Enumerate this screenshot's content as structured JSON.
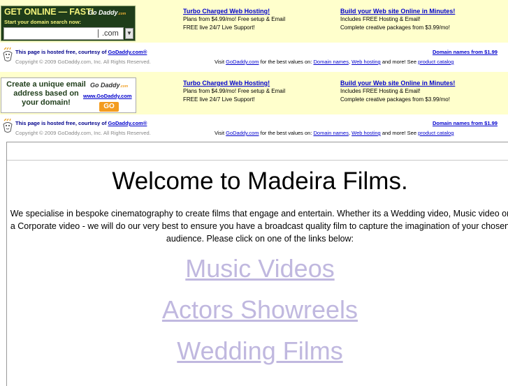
{
  "colors": {
    "ad_bg": "#ffffcc",
    "link_blue": "#0000cc",
    "nav_link": "#c0b8df",
    "banner_green": "#1f3d1a",
    "banner_yellow": "#f2f27a",
    "go_orange": "#f39c20"
  },
  "ad_top": {
    "banner": {
      "headline": "GET ONLINE — FAST!",
      "subline": "Start your domain search now:",
      "logo": "Go Daddy",
      "logo_suffix": ".com",
      "field_suffix": ".com",
      "dropdown_icon": "chevron-down-icon"
    },
    "col1": {
      "heading": "Turbo Charged Web Hosting!",
      "line1": "Plans from $4.99/mo! Free setup & Email",
      "line2": "FREE live 24/7 Live Support!"
    },
    "col2": {
      "heading": "Build your Web site Online in Minutes!",
      "line1": "Includes FREE Hosting & Email!",
      "line2": "Complete creative packages from $3.99/mo!"
    }
  },
  "credit_top": {
    "lead": "This page is hosted free, courtesy of",
    "link": "GoDaddy.com®",
    "copyright": "Copyright © 2009 GoDaddy.com, Inc. All Rights Reserved.",
    "right_link": "Domain names from $1.99",
    "visit_prefix": "Visit",
    "visit_link": "GoDaddy.com",
    "visit_mid": "for the best values on:",
    "link_domains": "Domain names",
    "sep": ",",
    "link_hosting": "Web hosting",
    "visit_more": "and more! See",
    "link_catalog": "product catalog"
  },
  "ad_bottom": {
    "banner": {
      "text": "Create a unique email address based on your domain!",
      "logo": "Go Daddy",
      "logo_suffix": ".com",
      "url": "www.GoDaddy.com",
      "go": "GO"
    },
    "col1": {
      "heading": "Turbo Charged Web Hosting!",
      "line1": "Plans from $4.99/mo! Free setup & Email",
      "line2": "FREE live 24/7 Live Support!"
    },
    "col2": {
      "heading": "Build your Web site Online in Minutes!",
      "line1": "Includes FREE Hosting & Email!",
      "line2": "Complete creative packages from $3.99/mo!"
    }
  },
  "credit_bottom": {
    "lead": "This page is hosted free, courtesy of",
    "link": "GoDaddy.com®",
    "copyright": "Copyright © 2009 GoDaddy.com, Inc. All Rights Reserved.",
    "right_link": "Domain names from $1.99",
    "visit_prefix": "Visit",
    "visit_link": "GoDaddy.com",
    "visit_mid": "for the best values on:",
    "link_domains": "Domain names",
    "sep": ",",
    "link_hosting": "Web hosting",
    "visit_more": "and more! See",
    "link_catalog": "product catalog"
  },
  "main": {
    "title": "Welcome to Madeira Films.",
    "intro": "We specialise in bespoke cinematography to create films that engage and entertain. Whether its a Wedding video, Music video or a Corporate video - we will do our very best to ensure you have a broadcast quality film to capture the imagination of your chosen audience. Please click on one of the links below:",
    "links": [
      "Music Videos",
      "Actors Showreels",
      "Wedding Films"
    ]
  }
}
